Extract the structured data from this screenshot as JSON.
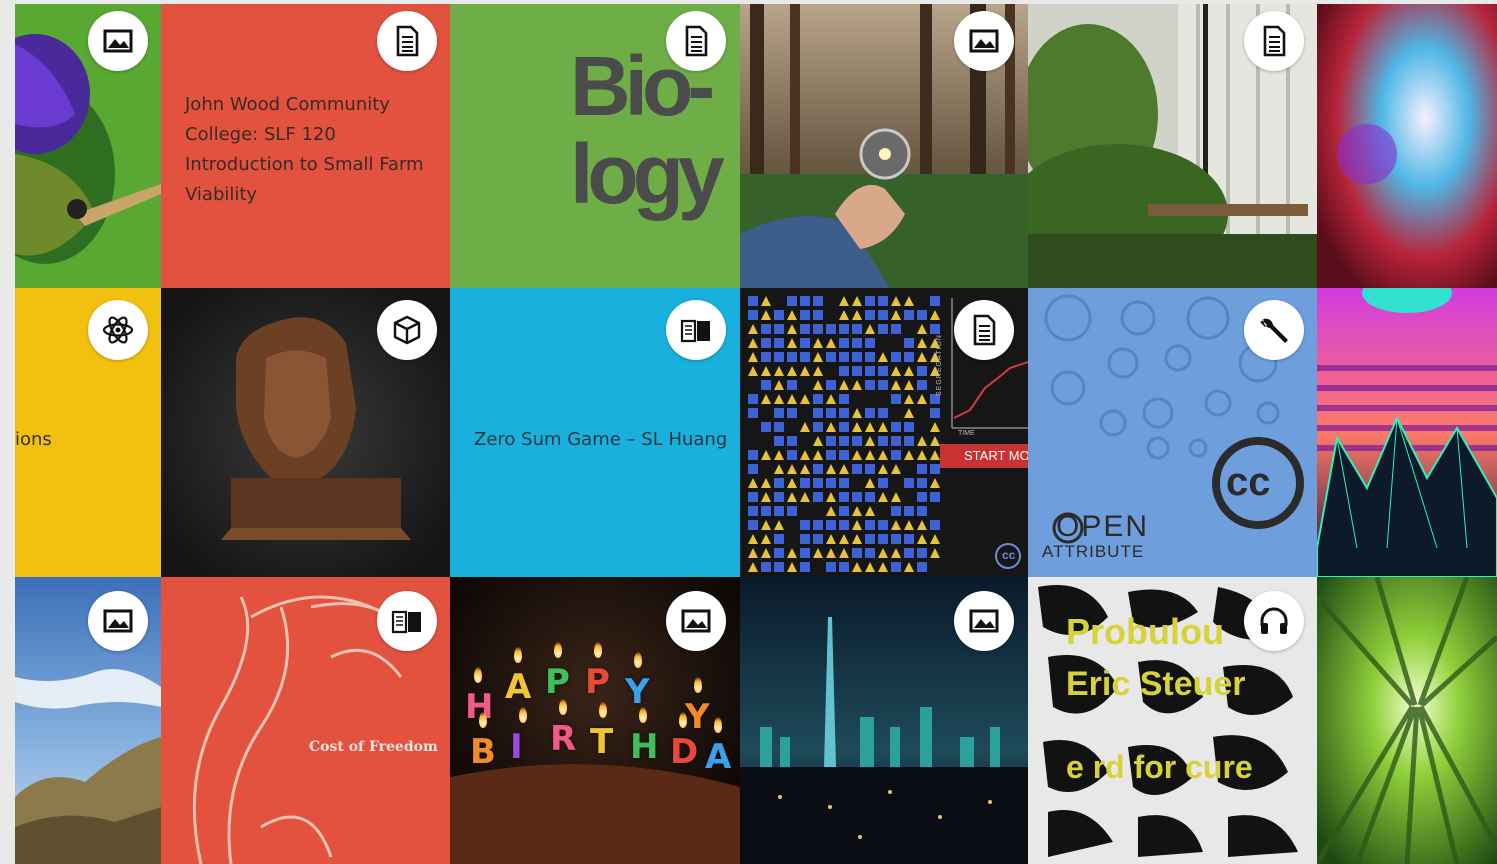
{
  "tiles": {
    "r1c0": {
      "type_icon": "image-icon"
    },
    "r1c1": {
      "title": "John Wood Community College: SLF 120 Introduction to Small Farm Viability",
      "type_icon": "document-icon"
    },
    "r1c2": {
      "big_text_1": "Bio-",
      "big_text_2": "logy",
      "type_icon": "document-icon"
    },
    "r1c3": {
      "type_icon": "image-icon"
    },
    "r1c4": {
      "type_icon": "document-icon"
    },
    "r1c5": {},
    "r2c0": {
      "title_fragment": "ions",
      "type_icon": "atom-icon"
    },
    "r2c1": {
      "type_icon": "cube-3d-icon"
    },
    "r2c2": {
      "title": "Zero Sum Game – SL Huang",
      "type_icon": "book-icon"
    },
    "r2c3": {
      "graph_axis_y": "SEGREGATION",
      "graph_axis_x": "TIME",
      "button_label": "START MOVIN",
      "cc_label": "cc",
      "type_icon": "document-icon"
    },
    "r2c4": {
      "brand_line_1": "OPEN",
      "brand_line_2": "ATTRIBUTE",
      "cc_big": "cc",
      "type_icon": "wrench-icon"
    },
    "r2c5": {},
    "r3c0": {
      "type_icon": "image-icon"
    },
    "r3c1": {
      "cover_title": "Cost of Freedom",
      "type_icon": "book-icon"
    },
    "r3c2": {
      "candles": [
        "H",
        "A",
        "P",
        "P",
        "Y",
        "B",
        "I",
        "R",
        "T",
        "H",
        "D",
        "A",
        "Y"
      ],
      "type_icon": "image-icon"
    },
    "r3c3": {
      "type_icon": "image-icon"
    },
    "r3c4": {
      "line_1": "Probulou",
      "line_2": "Eric Steuer",
      "line_3": "e rd for cure",
      "type_icon": "headphones-icon"
    },
    "r3c5": {}
  },
  "colors": {
    "red": "#e2523f",
    "green": "#6fae47",
    "yellow": "#f2c00f",
    "cyan": "#1ab0dd",
    "dark": "#1c1c1c",
    "cc_blue": "#6a9bd8"
  }
}
